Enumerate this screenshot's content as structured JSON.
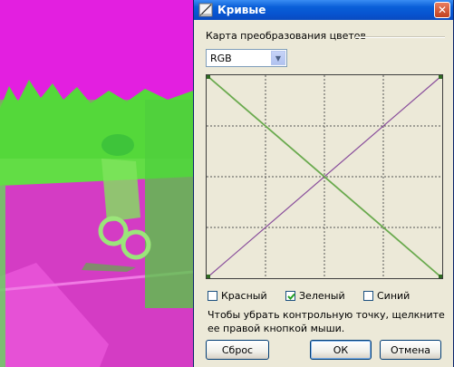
{
  "window": {
    "title": "Кривые",
    "close_glyph": "✕"
  },
  "mapping": {
    "group_label": "Карта преобразования цветов",
    "channel_value": "RGB",
    "channel_options": [
      "RGB"
    ]
  },
  "channels": [
    {
      "label": "Красный",
      "checked": false
    },
    {
      "label": "Зеленый",
      "checked": true
    },
    {
      "label": "Синий",
      "checked": false
    }
  ],
  "hint": "Чтобы убрать контрольную точку, щелкните ее правой кнопкой мыши.",
  "buttons": {
    "reset": "Сброс",
    "ok": "ОК",
    "cancel": "Отмена"
  },
  "colors": {
    "green_curve": "#6aaa4e",
    "rgb_curve": "#8a4f9c",
    "grid": "#555555",
    "title_bar": "#0a5fd8"
  }
}
